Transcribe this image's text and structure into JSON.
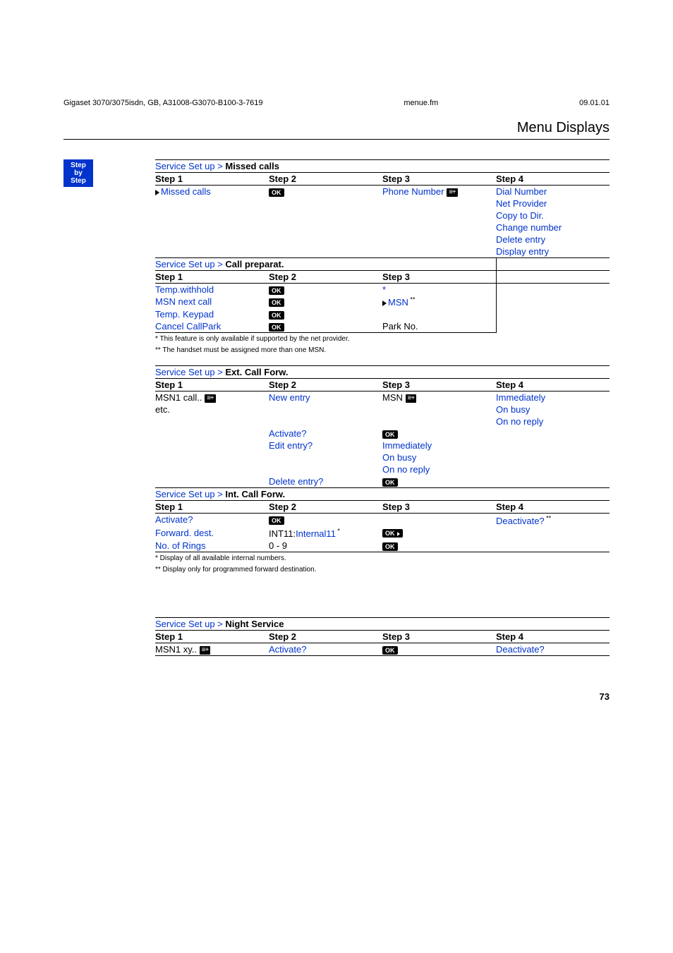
{
  "header": {
    "left": "Gigaset 3070/3075isdn, GB, A31008-G3070-B100-3-7619",
    "center": "menue.fm",
    "right": "09.01.01"
  },
  "section_title": "Menu Displays",
  "step_badge": {
    "l1": "Step",
    "l2": "by",
    "l3": "Step"
  },
  "missed": {
    "caption_prefix": "Service Set up > ",
    "caption_bold": "Missed calls",
    "hdr": {
      "c1": "Step 1",
      "c2": "Step 2",
      "c3": "Step 3",
      "c4": "Step 4"
    },
    "rows": [
      {
        "c1": "Missed calls",
        "c2": "OK",
        "c3": "Phone Number",
        "c4": "Dial Number",
        "c1_tri": true,
        "c2_type": "ok",
        "c3_icon": "list"
      },
      {
        "c1": "",
        "c2": "",
        "c3": "",
        "c4": "Net Provider"
      },
      {
        "c1": "",
        "c2": "",
        "c3": "",
        "c4": "Copy to Dir."
      },
      {
        "c1": "",
        "c2": "",
        "c3": "",
        "c4": "Change number"
      },
      {
        "c1": "",
        "c2": "",
        "c3": "",
        "c4": "Delete entry"
      },
      {
        "c1": "",
        "c2": "",
        "c3": "",
        "c4": "Display entry"
      }
    ]
  },
  "callprep": {
    "caption_prefix": "Service Set up > ",
    "caption_bold": "Call preparat.",
    "hdr": {
      "c1": "Step 1",
      "c2": "Step 2",
      "c3": "Step 3"
    },
    "rows": [
      {
        "c1": "Temp.withhold",
        "c2": "OK",
        "c3": "*",
        "c2_type": "ok"
      },
      {
        "c1": "MSN next call",
        "c2": "OK",
        "c3": "MSN",
        "c3_sup": "**",
        "c3_tri": true,
        "c2_type": "ok"
      },
      {
        "c1": "Temp. Keypad",
        "c2": "OK",
        "c3": "",
        "c2_type": "ok"
      },
      {
        "c1": "Cancel CallPark",
        "c2": "OK",
        "c3": "Park No.",
        "c2_type": "ok",
        "c3_black": true
      }
    ],
    "notes": [
      "*   This feature is only available if supported by the net provider.",
      "** The handset must be assigned more than one MSN."
    ]
  },
  "extforw": {
    "caption_prefix": "Service Set up > ",
    "caption_bold": "Ext. Call Forw.",
    "hdr": {
      "c1": "Step 1",
      "c2": "Step 2",
      "c3": "Step 3",
      "c4": "Step 4"
    },
    "rows": [
      {
        "c1": "MSN1 call..",
        "c1_icon": "list",
        "c2": "New entry",
        "c3": "MSN",
        "c3_icon": "list",
        "c4": "Immediately",
        "c1_black": true,
        "c3_black": true
      },
      {
        "c1": "etc.",
        "c2": "",
        "c3": "",
        "c4": "On busy",
        "c1_black": true
      },
      {
        "c1": "",
        "c2": "",
        "c3": "",
        "c4": "On no reply"
      },
      {
        "c1": "",
        "c2": "Activate?",
        "c3": "OK",
        "c3_type": "ok",
        "c4": ""
      },
      {
        "c1": "",
        "c2": "Edit entry?",
        "c3": "Immediately",
        "c4": ""
      },
      {
        "c1": "",
        "c2": "",
        "c3": "On busy",
        "c4": ""
      },
      {
        "c1": "",
        "c2": "",
        "c3": "On no reply",
        "c4": ""
      },
      {
        "c1": "",
        "c2": "Delete entry?",
        "c3": "OK",
        "c3_type": "ok",
        "c4": ""
      }
    ]
  },
  "intforw": {
    "caption_prefix": "Service Set up > ",
    "caption_bold": "Int. Call Forw.",
    "hdr": {
      "c1": "Step 1",
      "c2": "Step 2",
      "c3": "Step 3",
      "c4": "Step 4"
    },
    "rows": [
      {
        "c1": "Activate?",
        "c2": "OK",
        "c3": "",
        "c4": "Deactivate?",
        "c4_sup": "**",
        "c2_type": "ok"
      },
      {
        "c1": "Forward. dest.",
        "c2": "INT11:Internal11",
        "c2_sup": "*",
        "c3": "OK",
        "c3_type": "okarrow",
        "c4": "",
        "c2_mixed": true
      },
      {
        "c1": "No. of Rings",
        "c2": "0 - 9",
        "c3": "OK",
        "c3_type": "ok",
        "c4": "",
        "c2_black": true
      }
    ],
    "notes": [
      "*   Display of all available internal numbers.",
      "** Display only for programmed forward destination."
    ]
  },
  "night": {
    "caption_prefix": "Service Set up > ",
    "caption_bold": "Night Service",
    "hdr": {
      "c1": "Step 1",
      "c2": "Step 2",
      "c3": "Step 3",
      "c4": "Step 4"
    },
    "rows": [
      {
        "c1": "MSN1 xy..",
        "c1_icon": "list",
        "c2": "Activate?",
        "c3": "OK",
        "c3_type": "ok",
        "c4": "Deactivate?",
        "c1_black": true
      }
    ]
  },
  "page_num": "73"
}
